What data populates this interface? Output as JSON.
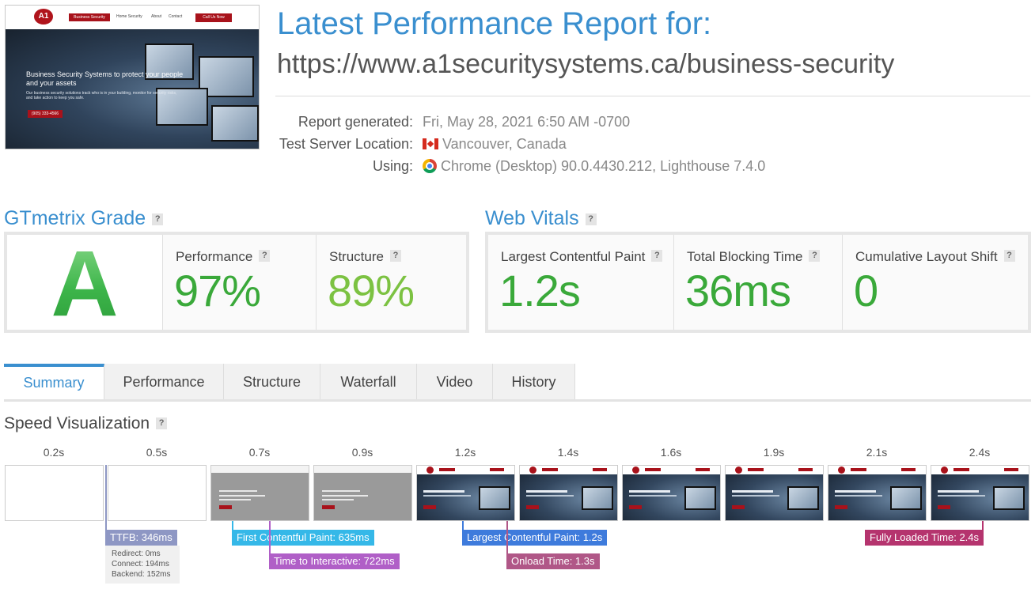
{
  "thumbnail": {
    "logo_text": "A1",
    "nav_items": [
      "Business Security",
      "Home Security",
      "About",
      "Contact"
    ],
    "nav_button": "Call Us Now",
    "hero_heading": "Business Security Systems to protect your people and your assets",
    "hero_text": "Our business security solutions track who is in your building, monitor for security risks, and take action to keep you safe.",
    "hero_button": "(905) 333-4566"
  },
  "header": {
    "title": "Latest Performance Report for:",
    "url": "https://www.a1securitysystems.ca/business-security"
  },
  "meta": {
    "report_generated_label": "Report generated:",
    "report_generated_value": "Fri, May 28, 2021 6:50 AM -0700",
    "location_label": "Test Server Location:",
    "location_value": "Vancouver, Canada",
    "location_icon": "canada-flag-icon",
    "using_label": "Using:",
    "using_value": "Chrome (Desktop) 90.0.4430.212, Lighthouse 7.4.0",
    "using_icon": "chrome-icon"
  },
  "gtmetrix": {
    "title": "GTmetrix Grade",
    "grade": "A",
    "performance_label": "Performance",
    "performance_value": "97%",
    "structure_label": "Structure",
    "structure_value": "89%"
  },
  "web_vitals": {
    "title": "Web Vitals",
    "lcp_label": "Largest Contentful Paint",
    "lcp_value": "1.2s",
    "tbt_label": "Total Blocking Time",
    "tbt_value": "36ms",
    "cls_label": "Cumulative Layout Shift",
    "cls_value": "0"
  },
  "help_mark": "?",
  "tabs": [
    "Summary",
    "Performance",
    "Structure",
    "Waterfall",
    "Video",
    "History"
  ],
  "active_tab": "Summary",
  "speed": {
    "title": "Speed Visualization",
    "ticks": [
      "0.2s",
      "0.5s",
      "0.7s",
      "0.9s",
      "1.2s",
      "1.4s",
      "1.6s",
      "1.9s",
      "2.1s",
      "2.4s"
    ],
    "markers": {
      "ttfb": "TTFB: 346ms",
      "fcp": "First Contentful Paint: 635ms",
      "tti": "Time to Interactive: 722ms",
      "lcp": "Largest Contentful Paint: 1.2s",
      "onload": "Onload Time: 1.3s",
      "fully_loaded": "Fully Loaded Time: 2.4s"
    },
    "ttfb_details": [
      "Redirect: 0ms",
      "Connect: 194ms",
      "Backend: 152ms"
    ]
  },
  "colors": {
    "accent": "#3a8fcf",
    "grade_green": "#3db54a",
    "performance_green": "#3aa93a",
    "structure_green": "#7cc242",
    "ttfb": "#8e97c4",
    "fcp": "#35b8e8",
    "tti": "#b05fc7",
    "lcp": "#3e7bdc",
    "onload": "#b05787",
    "fully_loaded": "#b5346e"
  }
}
